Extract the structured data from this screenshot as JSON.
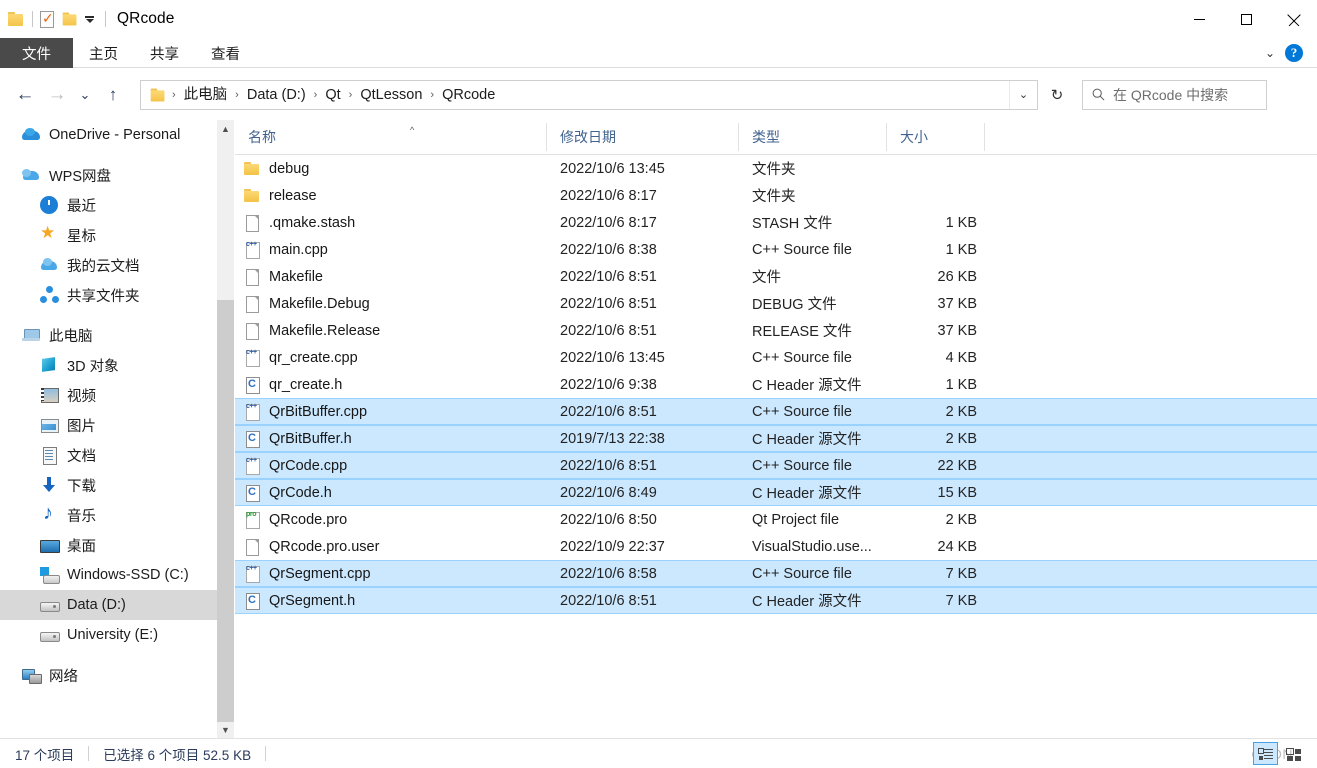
{
  "window": {
    "title": "QRcode",
    "quick_access": {
      "folder_icon": "folder-icon",
      "properties_icon": "properties-doc-icon",
      "new_folder_icon": "new-folder-icon",
      "customize_icon": "customize-caret-icon"
    },
    "controls": {
      "minimize": "minimize-icon",
      "maximize": "maximize-icon",
      "close": "close-icon"
    }
  },
  "ribbon": {
    "tabs": [
      {
        "label": "文件",
        "active": true
      },
      {
        "label": "主页",
        "active": false
      },
      {
        "label": "共享",
        "active": false
      },
      {
        "label": "查看",
        "active": false
      }
    ],
    "expand_icon": "chevron-down-icon",
    "help_label": "?"
  },
  "address": {
    "back_icon": "back-arrow-icon",
    "forward_icon": "forward-arrow-icon",
    "recent_icon": "recent-locations-chevron-icon",
    "up_icon": "up-arrow-icon",
    "path_icon": "folder-icon",
    "crumbs": [
      "此电脑",
      "Data (D:)",
      "Qt",
      "QtLesson",
      "QRcode"
    ],
    "separator": "›",
    "dropdown_icon": "chevron-down-icon",
    "refresh_icon": "refresh-icon",
    "refresh_glyph": "↻"
  },
  "search": {
    "icon": "search-icon",
    "placeholder": "在 QRcode 中搜索"
  },
  "sidebar": {
    "items": [
      {
        "label": "OneDrive - Personal",
        "icon": "onedrive-icon",
        "indent": 0,
        "selected": false,
        "gap_before": false
      },
      {
        "label": "WPS网盘",
        "icon": "wps-cloud-icon",
        "indent": 0,
        "selected": false,
        "gap_before": true
      },
      {
        "label": "最近",
        "icon": "clock-icon",
        "indent": 1,
        "selected": false,
        "gap_before": false
      },
      {
        "label": "星标",
        "icon": "star-icon",
        "indent": 1,
        "selected": false,
        "gap_before": false
      },
      {
        "label": "我的云文档",
        "icon": "cloud-doc-icon",
        "indent": 1,
        "selected": false,
        "gap_before": false
      },
      {
        "label": "共享文件夹",
        "icon": "share-folder-icon",
        "indent": 1,
        "selected": false,
        "gap_before": false
      },
      {
        "label": "此电脑",
        "icon": "this-pc-icon",
        "indent": 0,
        "selected": false,
        "gap_before": true
      },
      {
        "label": "3D 对象",
        "icon": "3d-objects-icon",
        "indent": 1,
        "selected": false,
        "gap_before": false
      },
      {
        "label": "视频",
        "icon": "videos-icon",
        "indent": 1,
        "selected": false,
        "gap_before": false
      },
      {
        "label": "图片",
        "icon": "pictures-icon",
        "indent": 1,
        "selected": false,
        "gap_before": false
      },
      {
        "label": "文档",
        "icon": "documents-icon",
        "indent": 1,
        "selected": false,
        "gap_before": false
      },
      {
        "label": "下载",
        "icon": "downloads-icon",
        "indent": 1,
        "selected": false,
        "gap_before": false
      },
      {
        "label": "音乐",
        "icon": "music-icon",
        "indent": 1,
        "selected": false,
        "gap_before": false
      },
      {
        "label": "桌面",
        "icon": "desktop-icon",
        "indent": 1,
        "selected": false,
        "gap_before": false
      },
      {
        "label": "Windows-SSD (C:)",
        "icon": "windows-drive-icon",
        "indent": 1,
        "selected": false,
        "gap_before": false
      },
      {
        "label": "Data (D:)",
        "icon": "hard-drive-icon",
        "indent": 1,
        "selected": true,
        "gap_before": false
      },
      {
        "label": "University (E:)",
        "icon": "hard-drive-icon",
        "indent": 1,
        "selected": false,
        "gap_before": false
      },
      {
        "label": "网络",
        "icon": "network-icon",
        "indent": 0,
        "selected": false,
        "gap_before": true
      }
    ],
    "scrollbar": {
      "up_icon": "scroll-up-icon",
      "down_icon": "scroll-down-icon"
    }
  },
  "filelist": {
    "columns": [
      {
        "label": "名称",
        "key": "name",
        "sorted": true,
        "sort_dir": "asc"
      },
      {
        "label": "修改日期",
        "key": "date",
        "sorted": false,
        "sort_dir": ""
      },
      {
        "label": "类型",
        "key": "type",
        "sorted": false,
        "sort_dir": ""
      },
      {
        "label": "大小",
        "key": "size",
        "sorted": false,
        "sort_dir": ""
      }
    ],
    "sort_indicator": "^",
    "rows": [
      {
        "name": "debug",
        "date": "2022/10/6 13:45",
        "type": "文件夹",
        "size": "",
        "icon": "folder-icon",
        "selected": false
      },
      {
        "name": "release",
        "date": "2022/10/6 8:17",
        "type": "文件夹",
        "size": "",
        "icon": "folder-icon",
        "selected": false
      },
      {
        "name": ".qmake.stash",
        "date": "2022/10/6 8:17",
        "type": "STASH 文件",
        "size": "1 KB",
        "icon": "generic-file-icon",
        "selected": false
      },
      {
        "name": "main.cpp",
        "date": "2022/10/6 8:38",
        "type": "C++ Source file",
        "size": "1 KB",
        "icon": "cpp-file-icon",
        "selected": false
      },
      {
        "name": "Makefile",
        "date": "2022/10/6 8:51",
        "type": "文件",
        "size": "26 KB",
        "icon": "generic-file-icon",
        "selected": false
      },
      {
        "name": "Makefile.Debug",
        "date": "2022/10/6 8:51",
        "type": "DEBUG 文件",
        "size": "37 KB",
        "icon": "generic-file-icon",
        "selected": false
      },
      {
        "name": "Makefile.Release",
        "date": "2022/10/6 8:51",
        "type": "RELEASE 文件",
        "size": "37 KB",
        "icon": "generic-file-icon",
        "selected": false
      },
      {
        "name": "qr_create.cpp",
        "date": "2022/10/6 13:45",
        "type": "C++ Source file",
        "size": "4 KB",
        "icon": "cpp-file-icon",
        "selected": false
      },
      {
        "name": "qr_create.h",
        "date": "2022/10/6 9:38",
        "type": "C Header 源文件",
        "size": "1 KB",
        "icon": "h-file-icon",
        "selected": false
      },
      {
        "name": "QrBitBuffer.cpp",
        "date": "2022/10/6 8:51",
        "type": "C++ Source file",
        "size": "2 KB",
        "icon": "cpp-file-icon",
        "selected": true
      },
      {
        "name": "QrBitBuffer.h",
        "date": "2019/7/13 22:38",
        "type": "C Header 源文件",
        "size": "2 KB",
        "icon": "h-file-icon",
        "selected": true
      },
      {
        "name": "QrCode.cpp",
        "date": "2022/10/6 8:51",
        "type": "C++ Source file",
        "size": "22 KB",
        "icon": "cpp-file-icon",
        "selected": true
      },
      {
        "name": "QrCode.h",
        "date": "2022/10/6 8:49",
        "type": "C Header 源文件",
        "size": "15 KB",
        "icon": "h-file-icon",
        "selected": true
      },
      {
        "name": "QRcode.pro",
        "date": "2022/10/6 8:50",
        "type": "Qt Project file",
        "size": "2 KB",
        "icon": "pro-file-icon",
        "selected": false
      },
      {
        "name": "QRcode.pro.user",
        "date": "2022/10/9 22:37",
        "type": "VisualStudio.use...",
        "size": "24 KB",
        "icon": "generic-file-icon",
        "selected": false
      },
      {
        "name": "QrSegment.cpp",
        "date": "2022/10/6 8:58",
        "type": "C++ Source file",
        "size": "7 KB",
        "icon": "cpp-file-icon",
        "selected": true
      },
      {
        "name": "QrSegment.h",
        "date": "2022/10/6 8:51",
        "type": "C Header 源文件",
        "size": "7 KB",
        "icon": "h-file-icon",
        "selected": true
      }
    ]
  },
  "statusbar": {
    "item_count": "17 个项目",
    "selection": "已选择 6 个项目  52.5 KB",
    "view_buttons": [
      {
        "name": "details-view-button",
        "active": true
      },
      {
        "name": "large-icons-view-button",
        "active": false
      }
    ]
  },
  "watermark": {
    "text": "CSDN"
  },
  "colors": {
    "selection_fill": "#cce8ff",
    "selection_border": "#99d1ff",
    "nav_selected": "#d8d8d8",
    "accent": "#0078d7",
    "file_tab": "#4a4a4a",
    "column_header_text": "#40638f",
    "status_text": "#2b3c5c"
  }
}
